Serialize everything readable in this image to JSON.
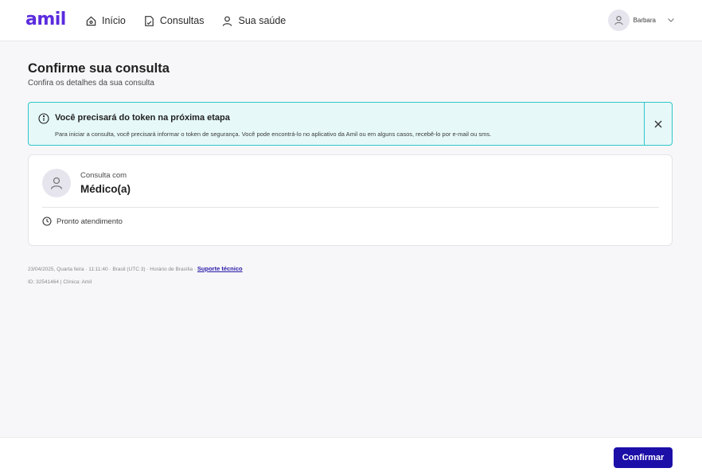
{
  "header": {
    "logo": "amil",
    "nav": [
      {
        "label": "Início",
        "icon": "home-icon"
      },
      {
        "label": "Consultas",
        "icon": "document-icon"
      },
      {
        "label": "Sua saúde",
        "icon": "person-icon"
      }
    ],
    "user": {
      "name": "Barbara",
      "icon": "user-avatar-icon"
    }
  },
  "page": {
    "title": "Confirme sua consulta",
    "subtitle": "Confira os detalhes da sua consulta"
  },
  "alert": {
    "title": "Você precisará do token na próxima etapa",
    "text": "Para iniciar a consulta, você precisará informar o token de segurança. Você pode encontrá-lo no aplicativo da Amil ou em alguns casos, recebê-lo por e-mail ou sms.",
    "accent": "#2fc7c7"
  },
  "card": {
    "label": "Consulta com",
    "doctor": "Médico(a)",
    "schedule": "Pronto atendimento"
  },
  "footer": {
    "datetime": "23/04/2025, Quarta feira · 11:11:40 · Brasil (UTC 3) · Horário de Brasília ·",
    "support_link": "Suporte técnico",
    "id_line": "ID: 32541464 | Clínica: Amil"
  },
  "actions": {
    "confirm_label": "Confirmar",
    "primary_color": "#1c0fa8"
  }
}
